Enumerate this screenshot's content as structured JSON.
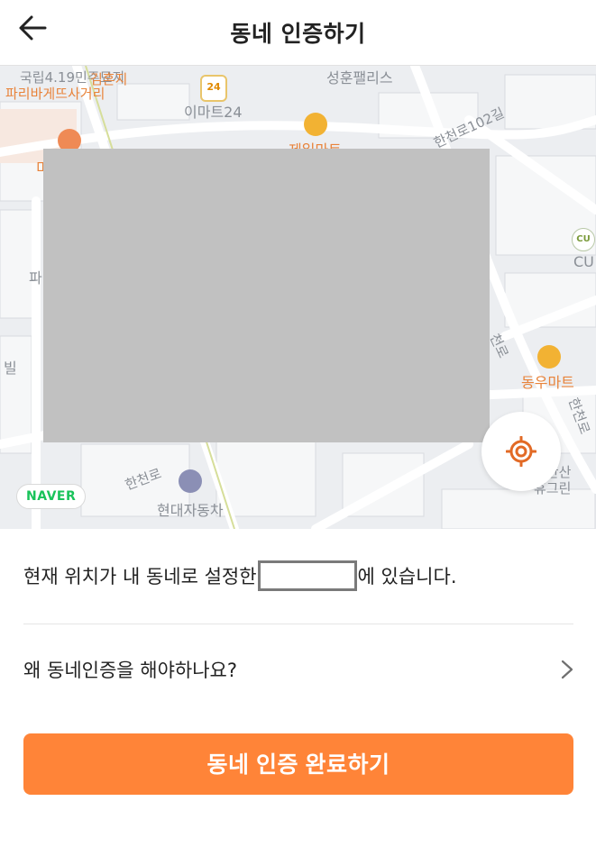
{
  "header": {
    "title": "동네 인증하기",
    "back_icon": "arrow-left-icon"
  },
  "map": {
    "labels": {
      "national_cemetery": "국립4.19민주묘지",
      "intersection": "파리바게뜨사거리",
      "overlap_orange": "김흔지",
      "emart24": "이마트24",
      "emart24_badge": "24",
      "palace": "성훈팰리스",
      "mart_left": "제일마트",
      "road_top": "한천로102길",
      "cu_icon": "CU",
      "cu": "CU",
      "mart_right": "동우마트",
      "road_right": "한천로",
      "road_left": "한천로",
      "road_mid": "천로",
      "green": "북한산\n휴그린",
      "hyundai": "현대자동차",
      "side_letter_1": "파",
      "side_letter_2": "빌",
      "side_letter_3": "미"
    },
    "provider_badge": "NAVER",
    "locate_icon": "crosshair-icon"
  },
  "status": {
    "prefix": "현재 위치가 내 동네로 설정한",
    "suffix": "에 있습니다."
  },
  "faq": {
    "label": "왜 동네인증을 해야하나요?",
    "chevron_icon": "chevron-right-icon"
  },
  "action": {
    "complete_label": "동네 인증 완료하기"
  },
  "colors": {
    "accent": "#ff8438",
    "naver_green": "#19c35a",
    "map_background": "#eceef1"
  }
}
